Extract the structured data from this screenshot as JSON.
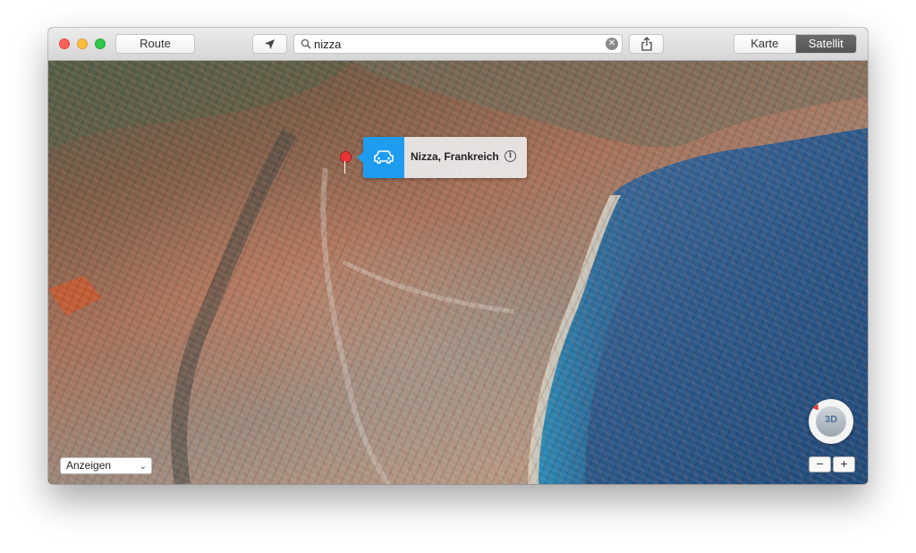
{
  "toolbar": {
    "route_label": "Route",
    "locate_icon": "location-arrow-icon",
    "share_icon": "share-icon"
  },
  "search": {
    "value": "nizza",
    "clear_icon": "clear-icon"
  },
  "map_type": {
    "options": [
      "Karte",
      "Satellit"
    ],
    "selected": "Satellit"
  },
  "map": {
    "callout": {
      "title": "Nizza, Frankreich",
      "icon": "car-icon",
      "info_icon": "info-icon",
      "accent": "#1e9cf0"
    },
    "pin_color": "#e83535",
    "show_select": {
      "value": "Anzeigen"
    },
    "compass_label": "3D",
    "zoom_out_label": "−",
    "zoom_in_label": "+"
  }
}
